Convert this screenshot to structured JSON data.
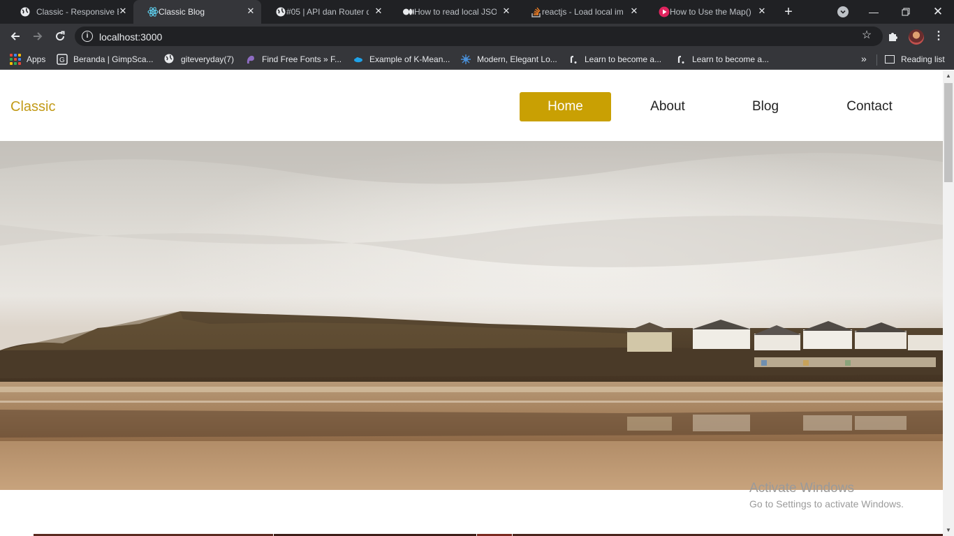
{
  "browser": {
    "tabs": [
      {
        "title": "Classic - Responsive Bl",
        "favicon": "globe-icon"
      },
      {
        "title": "Classic Blog",
        "favicon": "react-icon",
        "active": true
      },
      {
        "title": "#05 | API dan Router d",
        "favicon": "globe-icon"
      },
      {
        "title": "How to read local JSON",
        "favicon": "medium-icon"
      },
      {
        "title": "reactjs - Load local im",
        "favicon": "stackoverflow-icon"
      },
      {
        "title": "How to Use the Map()",
        "favicon": "video-icon"
      }
    ],
    "address": "localhost:3000",
    "bookmarks": [
      {
        "label": "Apps",
        "icon": "apps-grid-icon"
      },
      {
        "label": "Beranda | GimpSca...",
        "icon": "gimpscape-icon"
      },
      {
        "label": "giteveryday(7)",
        "icon": "globe-icon"
      },
      {
        "label": "Find Free Fonts » F...",
        "icon": "fonts-icon"
      },
      {
        "label": "Example of K-Mean...",
        "icon": "cloud-icon"
      },
      {
        "label": "Modern, Elegant Lo...",
        "icon": "spark-icon"
      },
      {
        "label": "Learn to become a...",
        "icon": "roadmap-icon"
      },
      {
        "label": "Learn to become a...",
        "icon": "roadmap-icon"
      }
    ],
    "reading_list": "Reading list",
    "colors": {
      "tabstrip": "#202124",
      "toolbar": "#35363a",
      "text": "#e8eaed"
    }
  },
  "page": {
    "logo": "Classic",
    "nav": [
      {
        "label": "Home",
        "active": true
      },
      {
        "label": "About"
      },
      {
        "label": "Blog"
      },
      {
        "label": "Contact"
      }
    ],
    "hero_image": "coastal-beach-photo",
    "colors": {
      "accent": "#c9a003",
      "logo": "#c29a17"
    }
  },
  "watermark": {
    "title": "Activate Windows",
    "subtitle": "Go to Settings to activate Windows."
  }
}
